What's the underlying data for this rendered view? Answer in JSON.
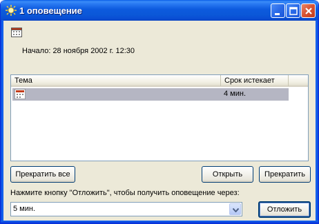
{
  "window": {
    "title": "1 оповещение",
    "icon": "reminder-bell-icon",
    "controls": [
      "minimize-icon",
      "maximize-icon",
      "close-icon"
    ]
  },
  "reminder": {
    "icon": "calendar-icon",
    "start_text": "Начало: 28 ноября 2002 г. 12:30"
  },
  "list": {
    "columns": [
      "Тема",
      "Срок истекает"
    ],
    "rows": [
      {
        "icon": "calendar-icon",
        "subject": "",
        "due": "4 мин.",
        "selected": true
      }
    ]
  },
  "buttons": {
    "dismiss_all": "Прекратить все",
    "open": "Открыть",
    "dismiss": "Прекратить",
    "snooze": "Отложить"
  },
  "snooze": {
    "prompt": "Нажмите кнопку \"Отложить\", чтобы получить оповещение через:",
    "selected": "5 мин."
  },
  "colors": {
    "titlebar": "#0a5ee8",
    "dialog_bg": "#ece9d8",
    "selection": "#b5b6c3"
  }
}
